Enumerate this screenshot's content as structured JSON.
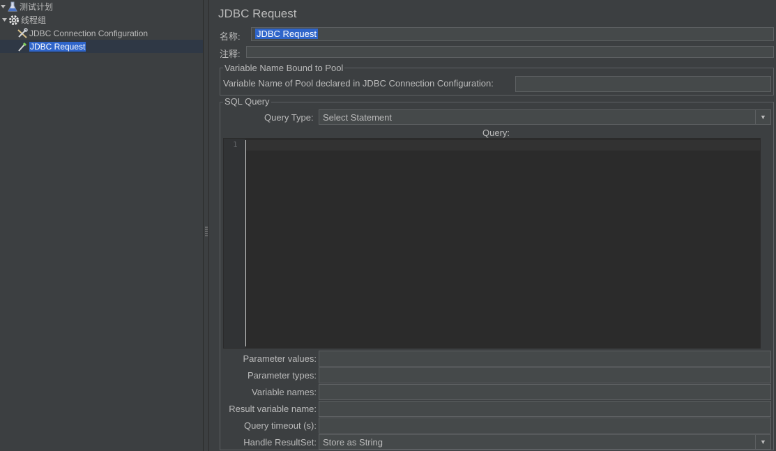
{
  "tree": {
    "items": [
      {
        "label": "测试计划",
        "icon": "flask-icon"
      },
      {
        "label": "线程组",
        "icon": "gear-icon"
      },
      {
        "label": "JDBC Connection Configuration",
        "icon": "wrench-icon"
      },
      {
        "label": "JDBC Request",
        "icon": "pipette-icon",
        "selected": true
      }
    ]
  },
  "panel": {
    "title": "JDBC Request",
    "name_label": "名称:",
    "name_value": "JDBC Request",
    "comment_label": "注释:",
    "comment_value": "",
    "pool_group": {
      "title": "Variable Name Bound to Pool",
      "pool_label": "Variable Name of Pool declared in JDBC Connection Configuration:",
      "pool_value": ""
    },
    "sql_group": {
      "title": "SQL Query",
      "query_type_label": "Query Type:",
      "query_type_value": "Select Statement",
      "query_label": "Query:",
      "line_number": "1",
      "query_text": ""
    },
    "params": {
      "param_values_label": "Parameter values:",
      "param_values": "",
      "param_types_label": "Parameter types:",
      "param_types": "",
      "variable_names_label": "Variable names:",
      "variable_names": "",
      "result_var_label": "Result variable name:",
      "result_var": "",
      "timeout_label": "Query timeout (s):",
      "timeout": "",
      "resultset_label": "Handle ResultSet:",
      "resultset_value": "Store as String"
    }
  },
  "colors": {
    "background": "#3c3f41",
    "selection": "#2f65ca",
    "editor_bg": "#2b2b2b",
    "text": "#bbbbbb"
  }
}
